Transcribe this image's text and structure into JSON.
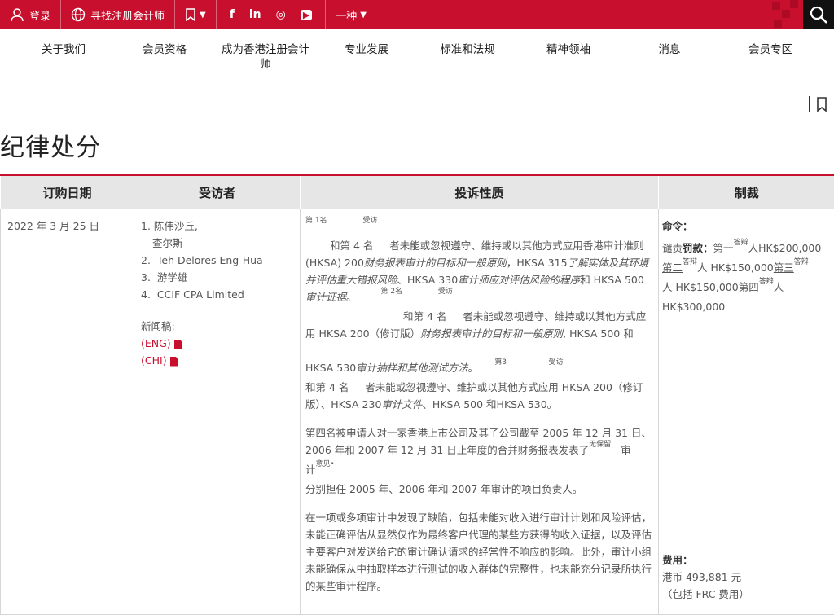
{
  "topbar": {
    "login": "登录",
    "find_cpa": "寻找注册会计师",
    "language": "一种",
    "social": [
      "f",
      "in",
      "◎",
      "▶"
    ]
  },
  "nav": {
    "items": [
      "关于我们",
      "会员资格",
      "成为香港注册会计师",
      "专业发展",
      "标准和法规",
      "精神领袖",
      "消息",
      "会员专区"
    ]
  },
  "page": {
    "title": "纪律处分"
  },
  "table": {
    "headers": [
      "订购日期",
      "受访者",
      "投诉性质",
      "制裁"
    ],
    "row": {
      "date": "2022 年 3 月 25 日",
      "respondents": [
        "陈伟沙丘,",
        "查尔斯",
        "Teh Delores Eng-Hua",
        "游学雄",
        "CCIF CPA Limited"
      ],
      "press_label": "新闻稿:",
      "eng": "(ENG)",
      "chi": "(CHI)",
      "c3": {
        "s1": "第 1名",
        "s2": "受访",
        "p1a": "和第 4 名",
        "p1b": "者未能或忽视遵守、维持或以其他方式应用香港审计准则 (HKSA) 200",
        "p1c": "财务报表审计的目标和一般原则",
        "p1d": "，HKSA 315",
        "p1e": "了解实体及其环境并评估重大错报风险",
        "p1f": "、HKSA 330",
        "p1g": "审计师应对评估风险的程序",
        "p1h": "和 HKSA 500",
        "p1i": "审计证据",
        "p1j": "。",
        "s3": "第 2名",
        "s4": "受访",
        "p1k": "和第 4 名",
        "p1l": "者未能或忽视遵守、维持或以其他方式应用 HKSA 200（修订版）",
        "p1m": "财务报表审计的目标和一般原则",
        "p1n": ", HKSA 500 和",
        "p1o": "HKSA 530",
        "p1p": "审计抽样和其他测试方法",
        "p1q": "。",
        "s5": "第3",
        "s6": "受访",
        "p1r": "和第 4 名",
        "p1s": "者未能或忽视遵守、维护或以其他方式应用 HKSA 200（修订版）、HKSA 230",
        "p1t": "审计文件",
        "p1u": "、HKSA 500 和HKSA 530。",
        "p2a": "第四名被申请人对一家香港上市公司及其子公司截至 2005 年 12 月 31 日、2006 年和 2007 年 12 月 31 日止年度的合并财务报表发表了",
        "s7": "无",
        "s8": "保留",
        "p2b": "审",
        "p2c": "计",
        "s9": "意见•",
        "p2d": "分别担任 2005 年、2006 年和 2007 年审计的项目负责人。",
        "p3": "在一项或多项审计中发现了缺陷，包括未能对收入进行审计计划和风险评估，未能正确评估从显然仅作为最终客户代理的某些方获得的收入证据，以及评估主要客户对发送给它的审计确认请求的经常性不响应的影响。此外，审计小组未能确保从中抽取样本进行测试的收入群体的完整性，也未能充分记录所执行的某些审计程序。"
      },
      "c4": {
        "order_label": "命令：",
        "a1": "谴责",
        "a2": "罚款：",
        "l1": "第一",
        "sup1": "答辩",
        "a3": "人HK$200,000",
        "l2": "第二",
        "sup2": "答辩",
        "a4": "人 HK$150,000",
        "l3": "第三",
        "sup3": "答辩",
        "a5": "人 HK$150,000",
        "l4": "第四",
        "sup4": "答辩",
        "a6": "人",
        "a7": "HK$300,000",
        "cost_label": "费用：",
        "cost": "港币 493,881 元",
        "cost_note": "（包括 FRC 费用）"
      }
    }
  }
}
